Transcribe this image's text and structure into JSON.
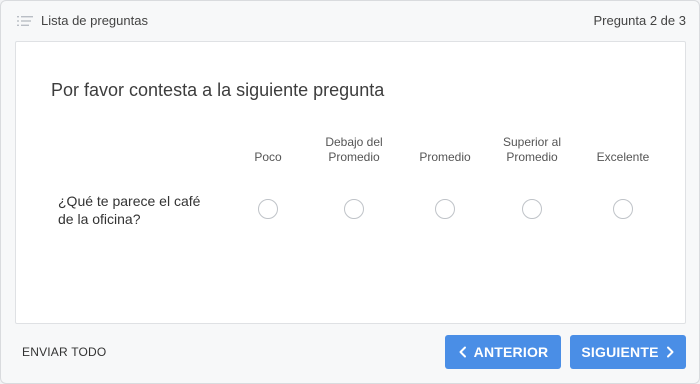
{
  "topbar": {
    "list_label": "Lista de preguntas",
    "list_icon": "list-icon",
    "counter": "Pregunta 2 de 3"
  },
  "question": {
    "heading": "Por favor contesta a la siguiente pregunta",
    "columns": [
      "Poco",
      "Debajo del Promedio",
      "Promedio",
      "Superior al Promedio",
      "Excelente"
    ],
    "column_lines": [
      [
        "Poco"
      ],
      [
        "Debajo del",
        "Promedio"
      ],
      [
        "Promedio"
      ],
      [
        "Superior al",
        "Promedio"
      ],
      [
        "Excelente"
      ]
    ],
    "row_label": "¿Qué te parece el café de la oficina?",
    "selected": null
  },
  "footer": {
    "send_all": "ENVIAR TODO",
    "prev": "ANTERIOR",
    "next": "SIGUIENTE",
    "accent_color": "#4a8ee6"
  }
}
